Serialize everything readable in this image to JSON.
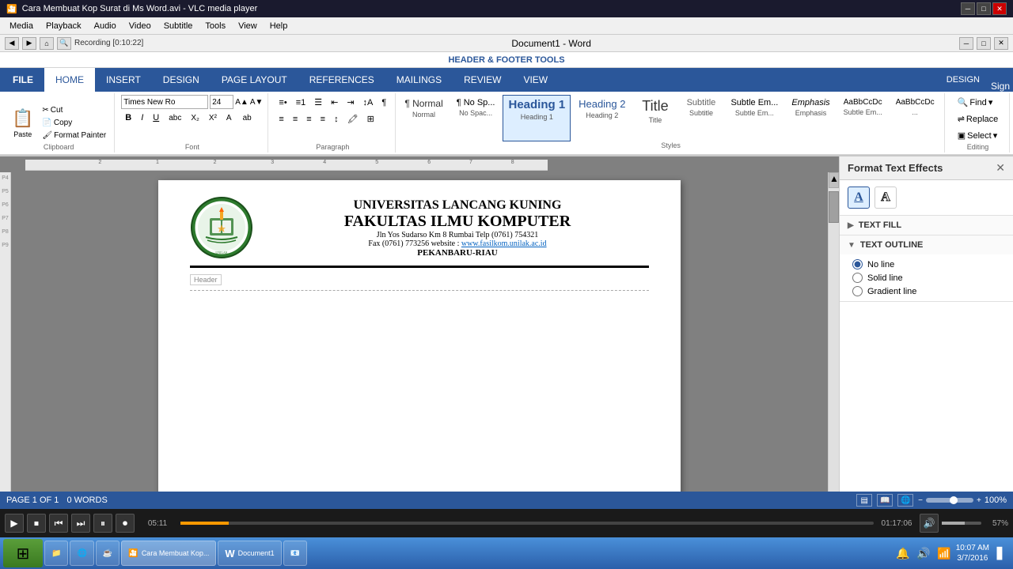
{
  "titleBar": {
    "title": "Cara Membuat Kop Surat di Ms Word.avi - VLC media player",
    "controls": [
      "minimize",
      "maximize",
      "close"
    ]
  },
  "menuBar": {
    "items": [
      "Media",
      "Playback",
      "Audio",
      "Video",
      "Subtitle",
      "Tools",
      "View",
      "Help"
    ]
  },
  "recordingBar": {
    "label": "Recording [0:10:22]",
    "docTitle": "Document1 - Word"
  },
  "hfToolsBar": {
    "label": "HEADER & FOOTER TOOLS",
    "tab": "DESIGN"
  },
  "ribbonTabs": {
    "items": [
      "FILE",
      "HOME",
      "INSERT",
      "DESIGN",
      "PAGE LAYOUT",
      "REFERENCES",
      "MAILINGS",
      "REVIEW",
      "VIEW"
    ],
    "active": "HOME",
    "hfDesignActive": true
  },
  "fontGroup": {
    "label": "Font",
    "fontName": "Times New Ro",
    "fontSize": "24",
    "boldLabel": "B",
    "italicLabel": "I",
    "underlineLabel": "U"
  },
  "paragraphGroup": {
    "label": "Paragraph"
  },
  "clipboardGroup": {
    "label": "Clipboard",
    "pasteLabel": "Paste",
    "cutLabel": "Cut",
    "copyLabel": "Copy",
    "formatPainterLabel": "Format Painter"
  },
  "stylesGroup": {
    "label": "Styles",
    "items": [
      {
        "id": "normal",
        "label": "¶ Normal",
        "sublabel": "Normal"
      },
      {
        "id": "no-spacing",
        "label": "¶ No Spac...",
        "sublabel": "No Spac..."
      },
      {
        "id": "heading1",
        "label": "Heading 1",
        "sublabel": "Heading 1",
        "active": true
      },
      {
        "id": "heading2",
        "label": "Heading 2",
        "sublabel": "Heading 2"
      },
      {
        "id": "title",
        "label": "Title",
        "sublabel": "Title"
      },
      {
        "id": "subtitle",
        "label": "Subtitle",
        "sublabel": "Subtitle"
      },
      {
        "id": "subtle-em",
        "label": "Subtle Em...",
        "sublabel": "Subtle Em..."
      },
      {
        "id": "emphasis",
        "label": "Emphasis",
        "sublabel": "Emphasis"
      },
      {
        "id": "style1",
        "label": "AaBbCcDc",
        "sublabel": "Subtle Em..."
      },
      {
        "id": "style2",
        "label": "AaBbCcDc",
        "sublabel": "..."
      }
    ]
  },
  "editingGroup": {
    "label": "Editing",
    "findLabel": "Find",
    "replaceLabel": "Replace",
    "selectLabel": "Select"
  },
  "formatTextEffectsPanel": {
    "title": "Format Text Effects",
    "icons": [
      {
        "id": "text-fill-icon",
        "symbol": "A",
        "style": "fill",
        "active": true
      },
      {
        "id": "text-effects-icon",
        "symbol": "A",
        "style": "outline"
      }
    ],
    "sections": [
      {
        "id": "text-fill",
        "label": "TEXT FILL",
        "expanded": false,
        "arrow": "▶"
      },
      {
        "id": "text-outline",
        "label": "TEXT OUTLINE",
        "expanded": true,
        "arrow": "▼",
        "options": [
          {
            "id": "no-line",
            "label": "No line",
            "checked": true
          },
          {
            "id": "solid-line",
            "label": "Solid line",
            "checked": false
          },
          {
            "id": "gradient-line",
            "label": "Gradient line",
            "checked": false
          }
        ]
      }
    ]
  },
  "documentContent": {
    "university": "UNIVERSITAS LANCANG KUNING",
    "faculty": "FAKULTAS ILMU KOMPUTER",
    "address": "Jln Yos Sudarso Km 8 Rumbai Telp (0761) 754321",
    "fax": "Fax (0761) 773256 website : ",
    "website": "www.fasilkom.unilak.ac.id",
    "city": "PEKANBARU-RIAU",
    "headerLabel": "Header"
  },
  "statusBar": {
    "page": "PAGE 1 OF 1",
    "words": "0 WORDS",
    "zoom": "100%"
  },
  "vlcControls": {
    "timeElapsed": "05:11",
    "timeTotal": "01:17:06",
    "volume": "57%"
  },
  "taskbar": {
    "startLabel": "⊞",
    "apps": [
      {
        "id": "windows",
        "label": ""
      },
      {
        "id": "explorer",
        "label": "📁"
      },
      {
        "id": "app1",
        "label": "🌐"
      },
      {
        "id": "vlc",
        "label": "🎬",
        "active": true
      },
      {
        "id": "word",
        "label": "W"
      },
      {
        "id": "app5",
        "label": "📧"
      }
    ],
    "time": "10:07 AM",
    "date": "3/7/2016"
  }
}
